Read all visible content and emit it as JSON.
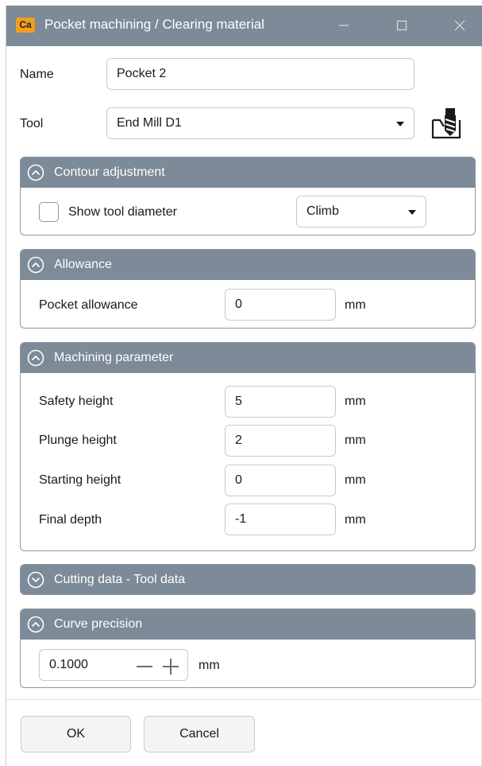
{
  "window": {
    "app_icon_text": "Ca",
    "title": "Pocket machining / Clearing material",
    "controls": [
      "minimize-icon",
      "maximize-icon",
      "close-icon"
    ]
  },
  "name": {
    "label": "Name",
    "value": "Pocket 2"
  },
  "tool": {
    "label": "Tool",
    "value": "End Mill D1",
    "icon": "tool-holder-icon"
  },
  "contour_adjustment": {
    "title": "Contour adjustment",
    "expanded": true,
    "show_tool_diameter_label": "Show tool diameter",
    "show_tool_diameter_checked": false,
    "direction_value": "Climb"
  },
  "allowance": {
    "title": "Allowance",
    "expanded": true,
    "pocket_allowance_label": "Pocket allowance",
    "pocket_allowance_value": "0",
    "unit": "mm"
  },
  "machining_parameter": {
    "title": "Machining parameter",
    "expanded": true,
    "rows": [
      {
        "label": "Safety height",
        "value": "5",
        "unit": "mm"
      },
      {
        "label": "Plunge height",
        "value": "2",
        "unit": "mm"
      },
      {
        "label": "Starting height",
        "value": "0",
        "unit": "mm"
      },
      {
        "label": "Final depth",
        "value": "-1",
        "unit": "mm"
      }
    ]
  },
  "cutting_data": {
    "title": "Cutting data - Tool data",
    "expanded": false
  },
  "curve_precision": {
    "title": "Curve precision",
    "expanded": true,
    "value": "0.1000",
    "unit": "mm"
  },
  "footer": {
    "ok_label": "OK",
    "cancel_label": "Cancel"
  },
  "colors": {
    "header_bg": "#7d8a97",
    "panel_border": "#8b96a2",
    "field_border": "#c6cace",
    "app_icon_bg": "#f0a01c"
  }
}
